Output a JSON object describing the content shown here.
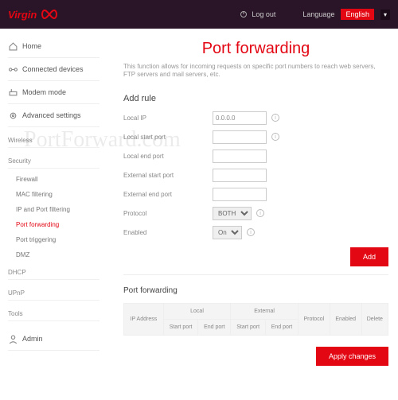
{
  "topbar": {
    "logout": "Log out",
    "language_label": "Language",
    "language_value": "English"
  },
  "nav": {
    "home": "Home",
    "connected": "Connected devices",
    "modem": "Modem mode",
    "advanced": "Advanced settings",
    "wireless": "Wireless",
    "security": "Security",
    "sec_items": [
      "Firewall",
      "MAC filtering",
      "IP and Port filtering",
      "Port forwarding",
      "Port triggering",
      "DMZ"
    ],
    "dhcp": "DHCP",
    "upnp": "UPnP",
    "tools": "Tools",
    "admin": "Admin"
  },
  "page": {
    "title": "Port forwarding",
    "desc": "This function allows for incoming requests on specific port numbers to reach web servers, FTP servers and mail servers, etc.",
    "addrule": "Add rule",
    "labels": {
      "local_ip": "Local IP",
      "local_start": "Local start port",
      "local_end": "Local end port",
      "ext_start": "External start port",
      "ext_end": "External end port",
      "protocol": "Protocol",
      "enabled": "Enabled"
    },
    "values": {
      "local_ip": "0.0.0.0",
      "protocol": "BOTH",
      "enabled": "On"
    },
    "add_btn": "Add",
    "table_title": "Port forwarding",
    "th": {
      "local": "Local",
      "external": "External",
      "ip": "IP Address",
      "sp": "Start port",
      "ep": "End port",
      "proto": "Protocol",
      "en": "Enabled",
      "del": "Delete"
    },
    "apply": "Apply changes"
  },
  "watermark": "PortForward.com"
}
